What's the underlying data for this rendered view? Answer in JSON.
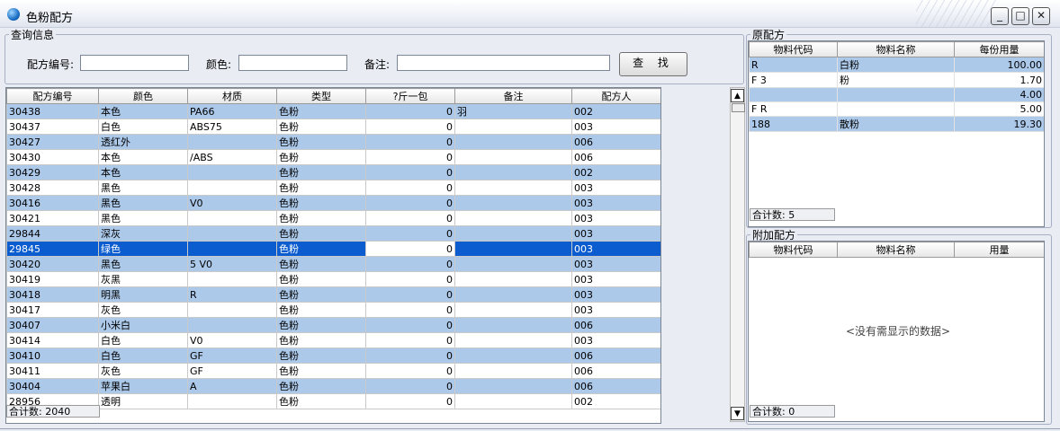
{
  "window": {
    "title": "色粉配方",
    "btn_min": "_",
    "btn_max": "□",
    "btn_close": "✕"
  },
  "query": {
    "legend": "查询信息",
    "recipe_no_label": "配方编号:",
    "color_label": "颜色:",
    "remark_label": "备注:",
    "search_button": "查 找",
    "recipe_no_value": "",
    "color_value": "",
    "remark_value": ""
  },
  "main_grid": {
    "columns": [
      "配方编号",
      "颜色",
      "材质",
      "类型",
      "?斤一包",
      "备注",
      "配方人"
    ],
    "rows": [
      [
        "30438",
        "本色",
        "PA66",
        "色粉",
        "0",
        "羽",
        "002"
      ],
      [
        "30437",
        "白色",
        "ABS75",
        "色粉",
        "0",
        "",
        "003"
      ],
      [
        "30427",
        "透红外",
        "",
        "色粉",
        "0",
        "",
        "006"
      ],
      [
        "30430",
        "本色",
        "",
        "色粉",
        "0",
        "",
        "006"
      ],
      [
        "30429",
        "本色",
        "",
        "色粉",
        "0",
        "",
        "002"
      ],
      [
        "30428",
        "黑色",
        "",
        "色粉",
        "0",
        "",
        "003"
      ],
      [
        "30416",
        "黑色",
        "",
        "色粉",
        "0",
        "",
        "003"
      ],
      [
        "30421",
        "黑色",
        "",
        "色粉",
        "0",
        "",
        "003"
      ],
      [
        "29844",
        "深灰",
        "",
        "色粉",
        "0",
        "",
        "003"
      ],
      [
        "29845",
        "绿色",
        "",
        "色粉",
        "0",
        "",
        "003"
      ],
      [
        "30420",
        "黑色",
        "",
        "色粉",
        "0",
        "",
        "003"
      ],
      [
        "30419",
        "灰黑",
        "",
        "色粉",
        "0",
        "",
        "003"
      ],
      [
        "30418",
        "明黑",
        "",
        "色粉",
        "0",
        "",
        "003"
      ],
      [
        "30417",
        "灰色",
        "",
        "色粉",
        "0",
        "",
        "003"
      ],
      [
        "30407",
        "小米白",
        "",
        "色粉",
        "0",
        "",
        "006"
      ],
      [
        "30414",
        "白色",
        "",
        "色粉",
        "0",
        "",
        "003"
      ],
      [
        "30410",
        "白色",
        "",
        "色粉",
        "0",
        "",
        "006"
      ],
      [
        "30411",
        "灰色",
        "",
        "色粉",
        "0",
        "",
        "006"
      ],
      [
        "30404",
        "苹果白",
        "",
        "色粉",
        "0",
        "",
        "006"
      ],
      [
        "28956",
        "透明",
        "",
        "色粉",
        "0",
        "",
        "002"
      ]
    ],
    "material_fragments": [
      "PA66",
      "ABS75",
      "",
      "/ABS",
      "",
      "",
      "V0",
      "",
      "",
      "",
      "5 V0",
      "",
      "R",
      "",
      "",
      "V0",
      "GF",
      "GF",
      "A",
      ""
    ],
    "remark_fragments": [
      "羽",
      "",
      "",
      "",
      "",
      "",
      "",
      "",
      "",
      "",
      "",
      "",
      "",
      "",
      "",
      "",
      "",
      "",
      "",
      ""
    ],
    "selected_row": 9,
    "total_label": "合计数: 2040"
  },
  "original_recipe": {
    "legend": "原配方",
    "columns": [
      "物料代码",
      "物料名称",
      "每份用量"
    ],
    "rows": [
      [
        "R",
        "白粉",
        "100.00"
      ],
      [
        "F 3",
        "粉",
        "1.70"
      ],
      [
        "",
        "",
        "4.00"
      ],
      [
        "F R",
        "",
        "5.00"
      ],
      [
        "188",
        "散粉",
        "19.30"
      ]
    ],
    "total_label": "合计数: 5"
  },
  "additional_recipe": {
    "legend": "附加配方",
    "columns": [
      "物料代码",
      "物料名称",
      "用量"
    ],
    "empty_text": "<没有需显示的数据>",
    "total_label": "合计数: 0"
  },
  "scrollbar": {
    "up": "▲",
    "down": "▼"
  }
}
